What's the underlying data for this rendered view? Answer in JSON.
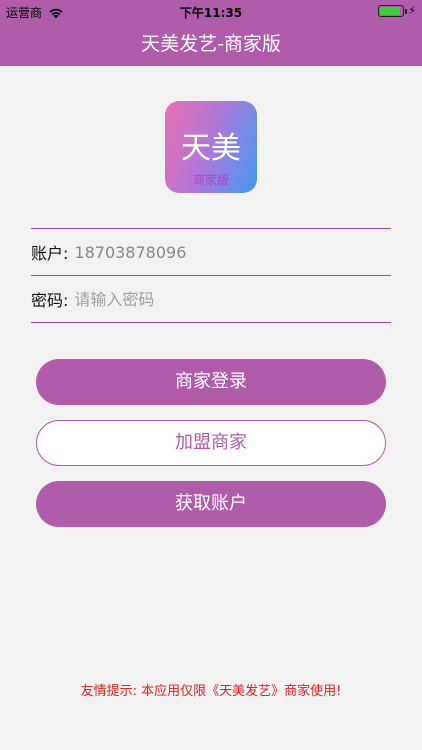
{
  "status_bar": {
    "carrier": "运营商",
    "time": "下午11:35"
  },
  "nav": {
    "title": "天美发艺-商家版"
  },
  "logo": {
    "big_text": "天美",
    "small_text": "商家版"
  },
  "form": {
    "account_label": "账户:",
    "account_value": "18703878096",
    "password_label": "密码:",
    "password_placeholder": "请输入密码"
  },
  "buttons": {
    "login": "商家登录",
    "join": "加盟商家",
    "get_account": "获取账户"
  },
  "tip": "友情提示: 本应用仅限《天美发艺》商家使用!",
  "colors": {
    "brand": "#b05caa",
    "tip": "#e02020",
    "background": "#f2f2f2"
  },
  "icons": [
    "wifi-icon",
    "battery-icon",
    "charging-bolt-icon"
  ]
}
